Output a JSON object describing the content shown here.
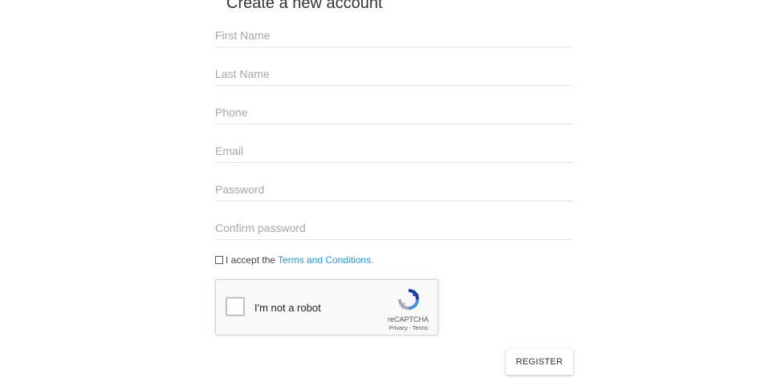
{
  "header": {
    "title": "Create a new account"
  },
  "form": {
    "fields": [
      {
        "placeholder": "First Name",
        "value": ""
      },
      {
        "placeholder": "Last Name",
        "value": ""
      },
      {
        "placeholder": "Phone",
        "value": ""
      },
      {
        "placeholder": "Email",
        "value": ""
      },
      {
        "placeholder": "Password",
        "value": ""
      },
      {
        "placeholder": "Confirm password",
        "value": ""
      }
    ],
    "terms": {
      "checked": false,
      "text": "I accept the",
      "link_text": "Terms and Conditions",
      "suffix": "."
    },
    "recaptcha": {
      "label": "I'm not a robot",
      "brand": "reCAPTCHA",
      "links": "Privacy - Terms",
      "icon": "recaptcha-logo-icon"
    },
    "submit_label": "REGISTER"
  },
  "colors": {
    "link": "#2196f3",
    "placeholder": "#a6a6a6",
    "underline": "#e3e3e3"
  }
}
